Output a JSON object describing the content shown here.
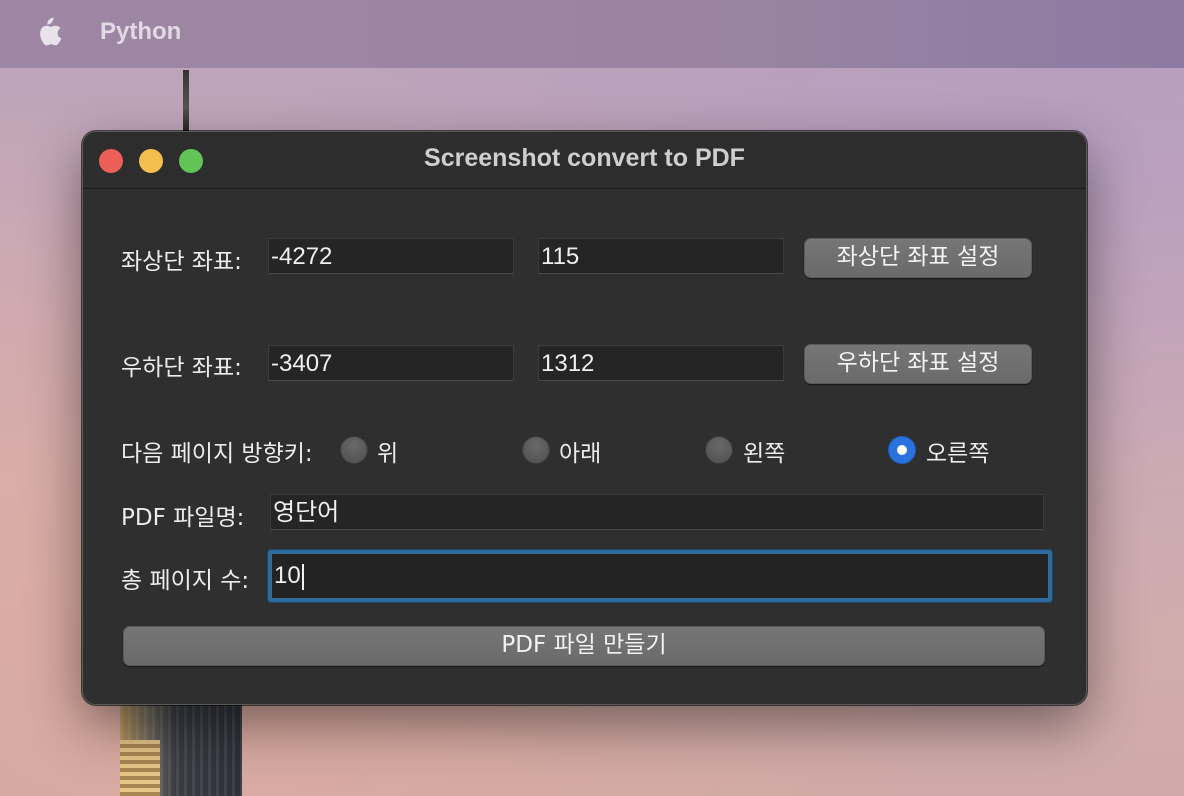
{
  "menubar": {
    "app_name": "Python"
  },
  "window": {
    "title": "Screenshot convert to PDF"
  },
  "top_left": {
    "label": "좌상단 좌표:",
    "x": "-4272",
    "y": "115",
    "button": "좌상단 좌표 설정"
  },
  "bottom_right": {
    "label": "우하단 좌표:",
    "x": "-3407",
    "y": "1312",
    "button": "우하단 좌표 설정"
  },
  "direction": {
    "label": "다음 페이지 방향키:",
    "options": [
      "위",
      "아래",
      "왼쪽",
      "오른쪽"
    ],
    "selected": "오른쪽"
  },
  "pdf_name": {
    "label": "PDF 파일명:",
    "value": "영단어"
  },
  "total_pages": {
    "label": "총 페이지 수:",
    "value": "10"
  },
  "create_button": "PDF 파일 만들기",
  "colors": {
    "accent": "#2a72de",
    "focus_ring": "#2d6b9c",
    "window_bg": "#2f2f2f"
  }
}
